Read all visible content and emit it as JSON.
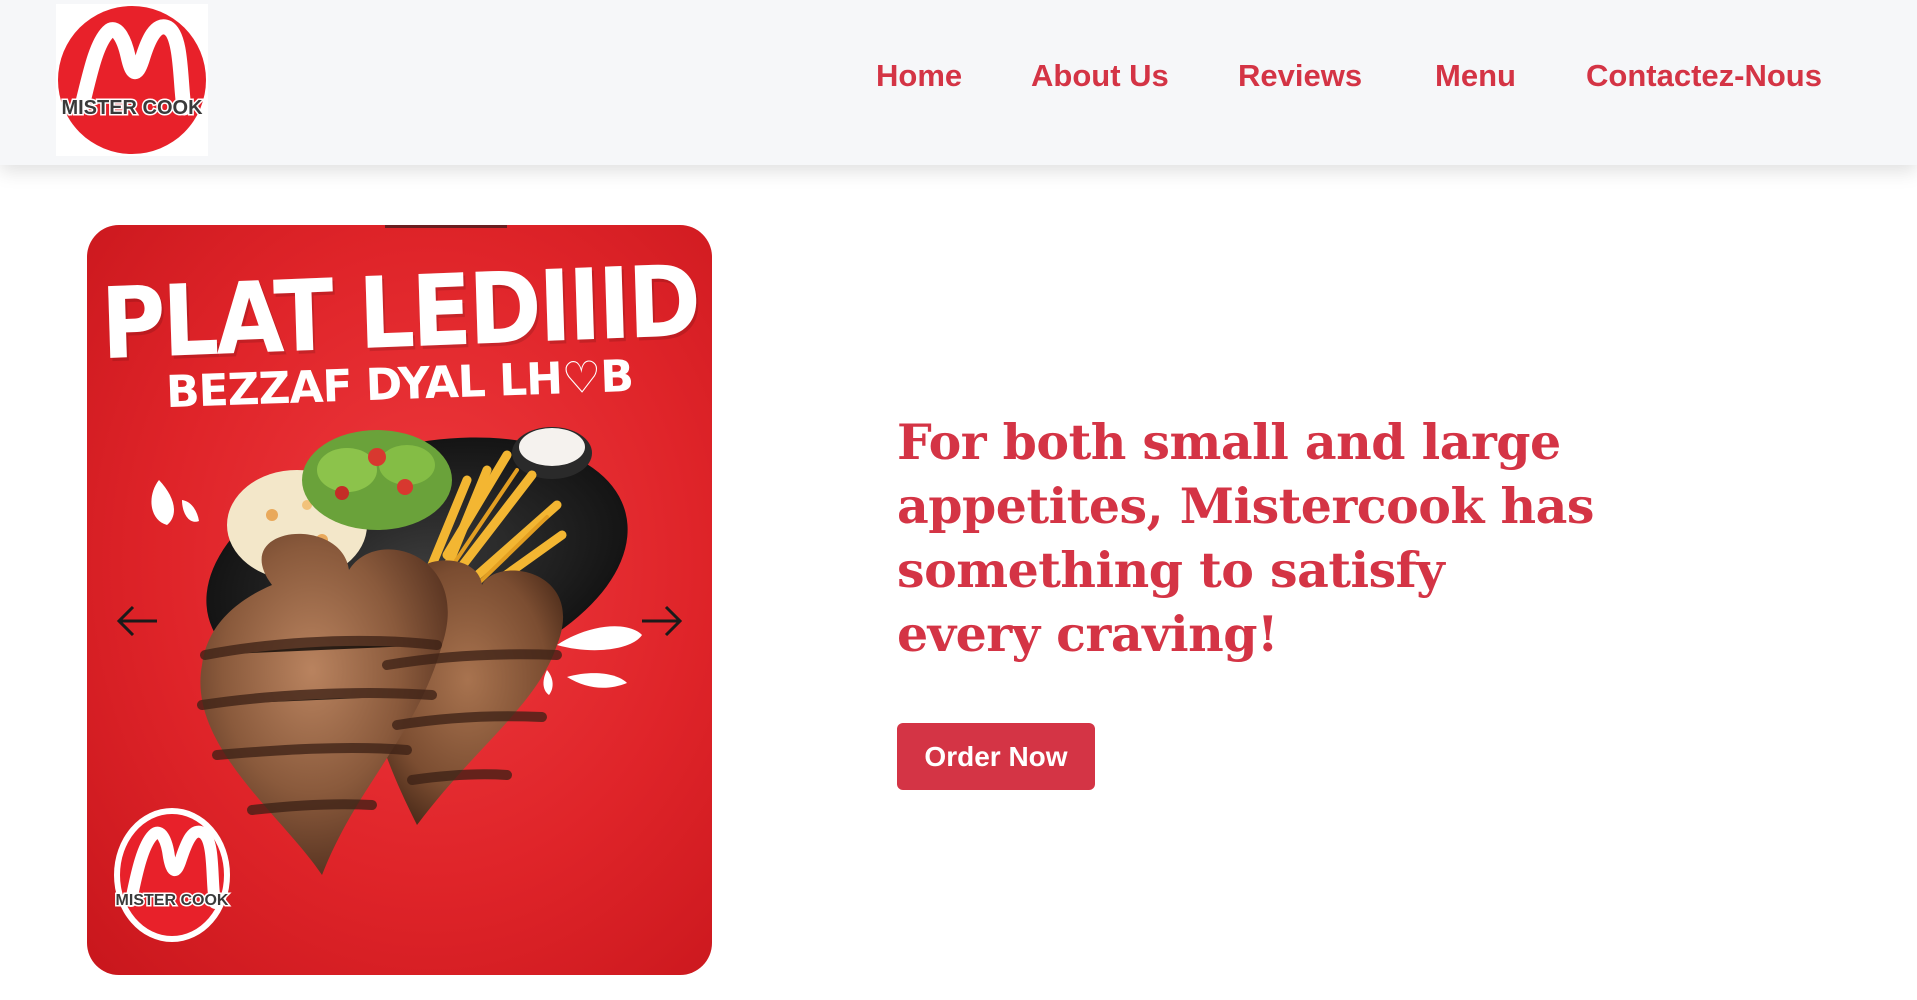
{
  "brand": {
    "name": "MISTER COOK",
    "logo_letter": "M",
    "color_red": "#e8212a",
    "color_text": "#d43445"
  },
  "nav": {
    "items": [
      {
        "label": "Home"
      },
      {
        "label": "About Us"
      },
      {
        "label": "Reviews"
      },
      {
        "label": "Menu"
      },
      {
        "label": "Contactez-Nous"
      }
    ]
  },
  "carousel": {
    "promo_title": "PLAT LEDIIID",
    "promo_subtitle": "BEZZAF DYAL LH♡B",
    "prev_icon": "arrow-left-icon",
    "next_icon": "arrow-right-icon",
    "background_color": "#df2429"
  },
  "hero": {
    "headline": "For both small and large appetites, Mistercook has something to satisfy every craving!",
    "cta_label": "Order Now",
    "cta_color": "#d43445"
  }
}
